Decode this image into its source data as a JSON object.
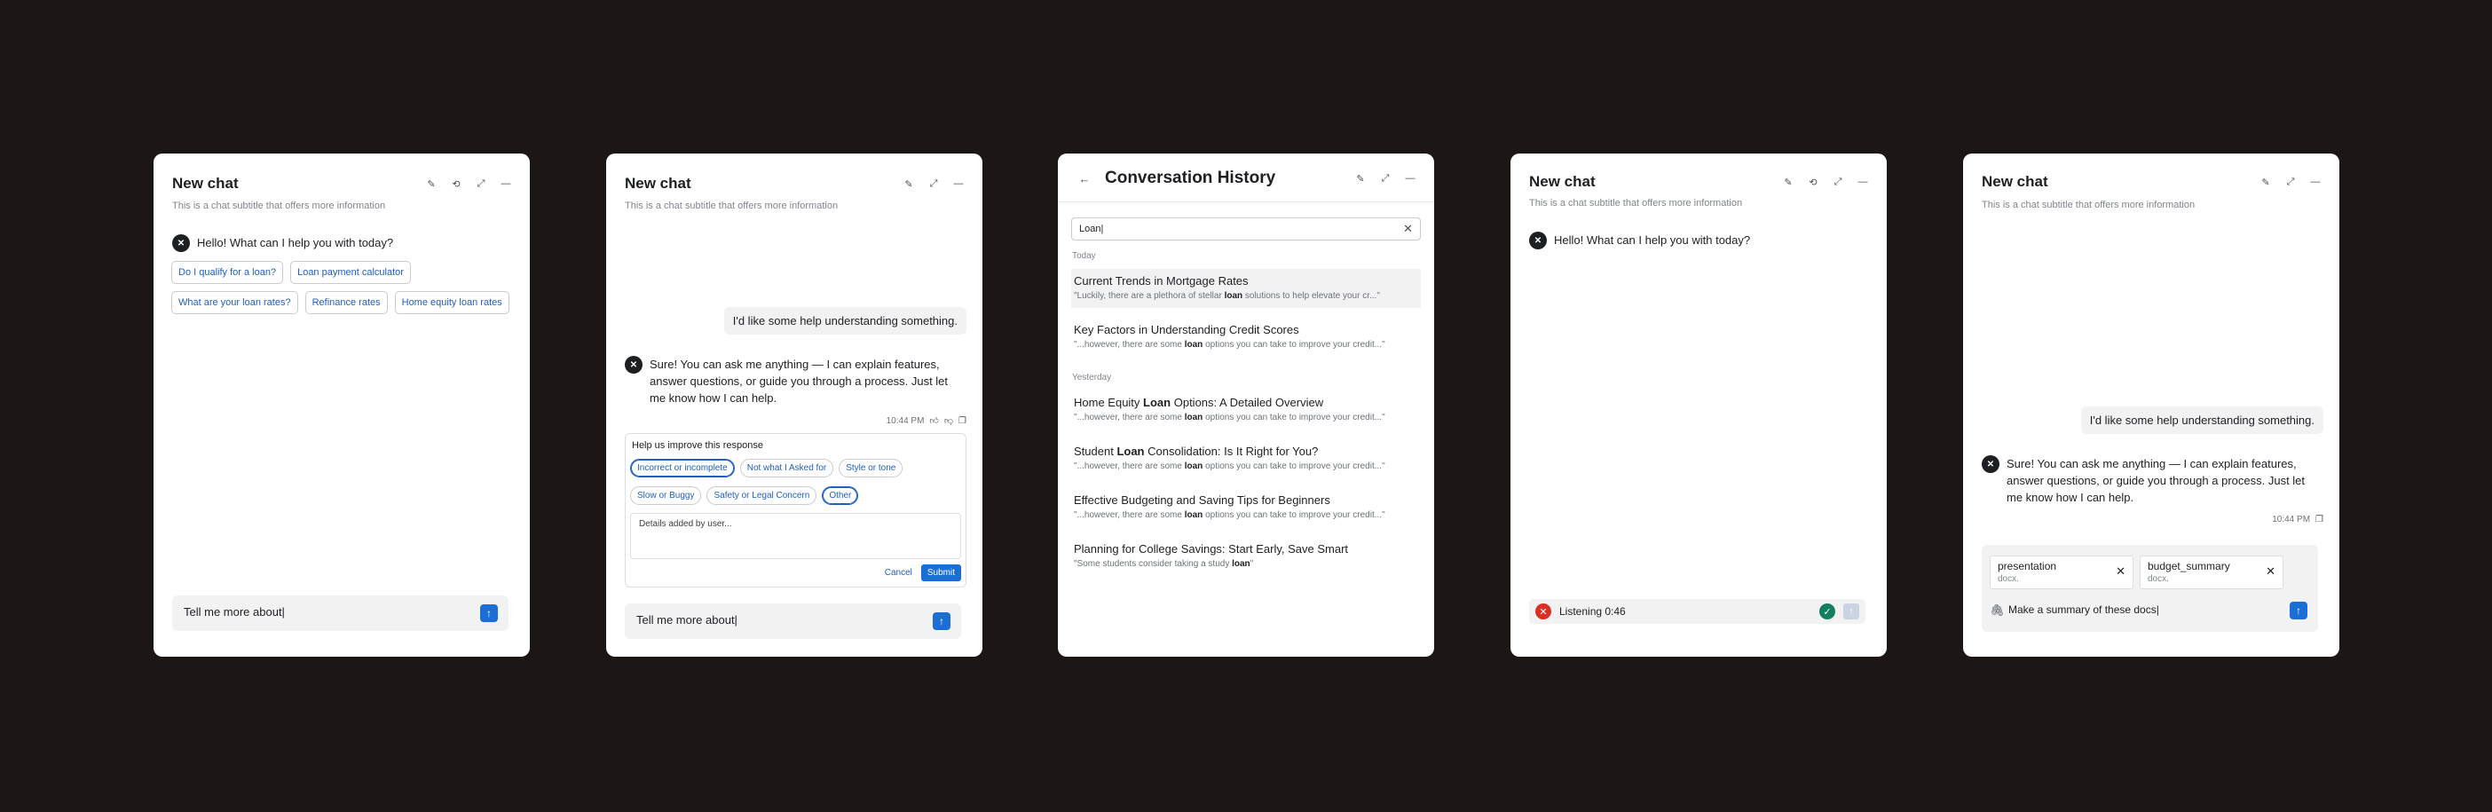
{
  "panel1": {
    "title": "New chat",
    "subtitle": "This is a chat subtitle that offers more information",
    "greeting": "Hello! What can I help you with today?",
    "suggestions_row1": [
      "Do I qualify for a loan?",
      "Loan payment calculator"
    ],
    "suggestions_row2": [
      "What are your loan rates?",
      "Refinance rates",
      "Home equity loan rates"
    ],
    "composer_text": "Tell me more about|"
  },
  "panel2": {
    "title": "New chat",
    "subtitle": "This is a chat subtitle that offers more information",
    "user_message": "I'd like some help understanding something.",
    "bot_reply": "Sure! You can ask me anything — I can explain features, answer questions, or guide you through a process. Just let me know how I can help.",
    "timestamp": "10:44 PM",
    "feedback": {
      "title": "Help us improve this response",
      "options_row1": [
        "Incorrect or incomplete",
        "Not what I Asked for",
        "Style or tone"
      ],
      "options_row2": [
        "Slow or Buggy",
        "Safety or Legal Concern",
        "Other"
      ],
      "details": "Details added by user...",
      "cancel": "Cancel",
      "submit": "Submit"
    },
    "composer_text": "Tell me more about|"
  },
  "panel3": {
    "title": "Conversation History",
    "search_value": "Loan|",
    "today_label": "Today",
    "yesterday_label": "Yesterday",
    "items": [
      {
        "pre": "Current Trends in Mortgage Rates",
        "bold": "",
        "post": "",
        "snip_pre": "\"Luckily, there are a plethora of stellar ",
        "snip_bold": "loan",
        "snip_post": " solutions to help elevate your cr...\""
      },
      {
        "pre": "Key Factors in Understanding Credit Scores",
        "bold": "",
        "post": "",
        "snip_pre": "\"...however, there are some ",
        "snip_bold": "loan",
        "snip_post": " options you can take to improve your credit...\""
      },
      {
        "pre": "Home Equity ",
        "bold": "Loan",
        "post": " Options: A Detailed Overview",
        "snip_pre": "\"...however, there are some ",
        "snip_bold": "loan",
        "snip_post": " options you can take to improve your credit...\""
      },
      {
        "pre": "Student ",
        "bold": "Loan",
        "post": " Consolidation: Is It Right for You?",
        "snip_pre": "\"...however, there are some ",
        "snip_bold": "loan",
        "snip_post": " options you can take to improve your credit...\""
      },
      {
        "pre": "Effective Budgeting and Saving Tips for Beginners",
        "bold": "",
        "post": "",
        "snip_pre": "\"...however, there are some ",
        "snip_bold": "loan",
        "snip_post": " options you can take to improve your credit...\""
      },
      {
        "pre": "Planning for College Savings: Start Early, Save Smart",
        "bold": "",
        "post": "",
        "snip_pre": "\"Some students consider taking a study ",
        "snip_bold": "loan",
        "snip_post": "\""
      }
    ]
  },
  "panel4": {
    "title": "New chat",
    "subtitle": "This is a chat subtitle that offers more information",
    "greeting": "Hello! What can I help you with today?",
    "listening": "Listening 0:46"
  },
  "panel5": {
    "title": "New chat",
    "subtitle": "This is a chat subtitle that offers more information",
    "user_message": "I'd like some help understanding something.",
    "bot_reply": "Sure! You can ask me anything — I can explain features, answer questions, or guide you through a process. Just let me know how I can help.",
    "timestamp": "10:44 PM",
    "files": [
      {
        "name": "presentation",
        "type": "docx."
      },
      {
        "name": "budget_summary",
        "type": "docx."
      }
    ],
    "composer_text": "Make a summary of these docs|"
  },
  "colors": {
    "background": "#1c1714",
    "accent": "#1a6ed6",
    "link": "#1f5fbf",
    "danger": "#d93025",
    "success": "#12805c"
  },
  "icons": [
    "edit-icon",
    "history-icon",
    "expand-icon",
    "minimize-icon",
    "back-arrow-icon",
    "send-icon",
    "copy-icon",
    "thumbs-up-icon",
    "thumbs-down-icon",
    "close-icon",
    "check-icon",
    "paperclip-icon"
  ]
}
